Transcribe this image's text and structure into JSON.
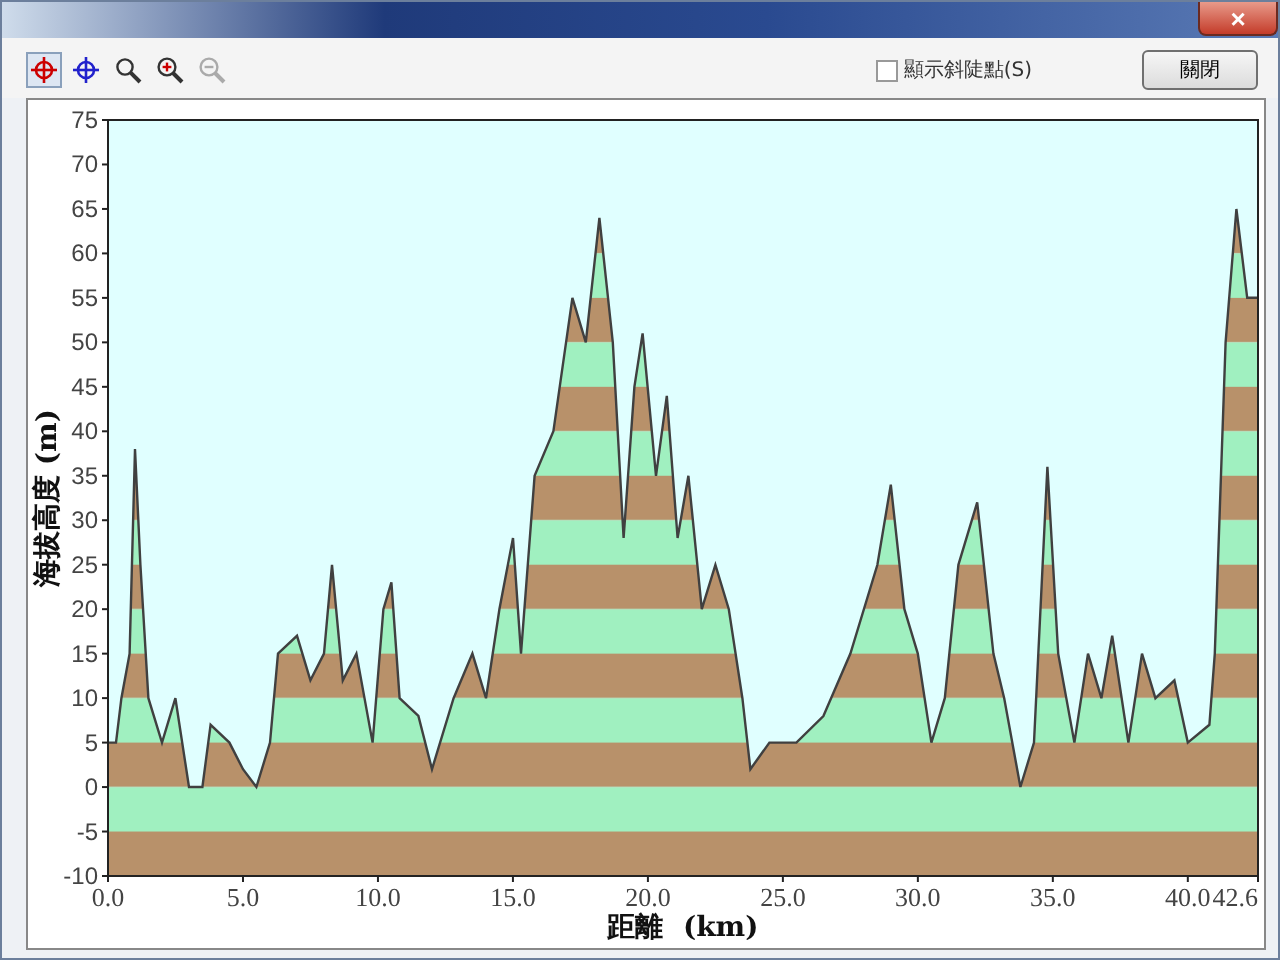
{
  "window": {
    "close": "×"
  },
  "toolbar": {
    "tools": [
      {
        "kind": "marker",
        "selected": true,
        "disabled": false
      },
      {
        "kind": "crosshair",
        "selected": false,
        "disabled": false
      },
      {
        "kind": "zoombox",
        "selected": false,
        "disabled": false
      },
      {
        "kind": "zoomin",
        "selected": false,
        "disabled": false
      },
      {
        "kind": "zoomout",
        "selected": false,
        "disabled": true
      }
    ],
    "checkbox": {
      "label": "顯示斜陡點(S)",
      "checked": false
    },
    "button": "關閉"
  },
  "chart": {
    "chart_data": {
      "type": "area",
      "xlabel": "距離  (km)",
      "ylabel": "海拔高度 (m)",
      "x": [
        0,
        0.3,
        0.5,
        0.8,
        1.0,
        1.2,
        1.5,
        2.0,
        2.5,
        3.0,
        3.5,
        3.8,
        4.5,
        5.0,
        5.5,
        6.0,
        6.3,
        7.0,
        7.5,
        8.0,
        8.3,
        8.7,
        9.2,
        9.8,
        10.2,
        10.5,
        10.8,
        11.5,
        12.0,
        12.8,
        13.5,
        14.0,
        14.5,
        15.0,
        15.3,
        15.8,
        16.5,
        17.2,
        17.7,
        18.2,
        18.7,
        19.1,
        19.5,
        19.8,
        20.3,
        20.7,
        21.1,
        21.5,
        22.0,
        22.5,
        23.0,
        23.5,
        23.8,
        24.5,
        25.5,
        26.5,
        27.5,
        28.5,
        29.0,
        29.5,
        30.0,
        30.5,
        31.0,
        31.5,
        32.2,
        32.8,
        33.2,
        33.8,
        34.3,
        34.8,
        35.2,
        35.8,
        36.3,
        36.8,
        37.2,
        37.8,
        38.3,
        38.8,
        39.5,
        40.0,
        40.8,
        41.0,
        41.4,
        41.8,
        42.2,
        42.6
      ],
      "series": [
        {
          "color": "#404040",
          "values": [
            5,
            5,
            10,
            15,
            38,
            25,
            10,
            5,
            10,
            0,
            0,
            7,
            5,
            2,
            0,
            5,
            15,
            17,
            12,
            15,
            25,
            12,
            15,
            5,
            20,
            23,
            10,
            8,
            2,
            10,
            15,
            10,
            20,
            28,
            15,
            35,
            40,
            55,
            50,
            64,
            50,
            28,
            45,
            51,
            35,
            44,
            28,
            35,
            20,
            25,
            20,
            10,
            2,
            5,
            5,
            8,
            15,
            25,
            34,
            20,
            15,
            5,
            10,
            25,
            32,
            15,
            10,
            0,
            5,
            36,
            15,
            5,
            15,
            10,
            17,
            5,
            15,
            10,
            12,
            5,
            7,
            15,
            50,
            65,
            55,
            55
          ]
        }
      ],
      "bands": [
        {
          "axis": "y",
          "from": -10,
          "to": 0
        }
      ],
      "xlim": [
        0,
        42.6
      ],
      "ylim": [
        -10,
        75
      ],
      "xticks": [
        {
          "value": 0,
          "label": "0.0"
        },
        {
          "value": 5,
          "label": "5.0"
        },
        {
          "value": 10,
          "label": "10.0"
        },
        {
          "value": 15,
          "label": "15.0"
        },
        {
          "value": 20,
          "label": "20.0"
        },
        {
          "value": 25,
          "label": "25.0"
        },
        {
          "value": 30,
          "label": "30.0"
        },
        {
          "value": 35,
          "label": "35.0"
        },
        {
          "value": 40,
          "label": "40.0"
        },
        {
          "value": 42.6,
          "label": "42.6"
        }
      ],
      "yticks": [
        -10,
        -5,
        0,
        5,
        10,
        15,
        20,
        25,
        30,
        35,
        40,
        45,
        50,
        55,
        60,
        65,
        70,
        75
      ]
    }
  }
}
